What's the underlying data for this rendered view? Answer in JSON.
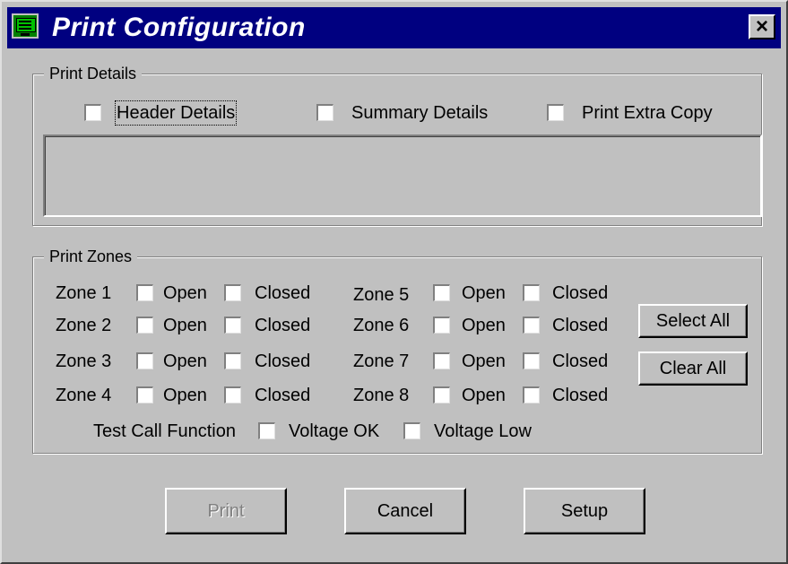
{
  "window": {
    "title": "Print Configuration",
    "close_label": "×"
  },
  "print_details": {
    "legend": "Print Details",
    "checkboxes": [
      {
        "label": "Header Details",
        "checked": false
      },
      {
        "label": "Summary Details",
        "checked": false
      },
      {
        "label": "Print Extra Copy",
        "checked": false
      }
    ]
  },
  "print_zones": {
    "legend": "Print Zones",
    "zones": [
      {
        "label": "Zone 1",
        "open": "Open",
        "closed": "Closed"
      },
      {
        "label": "Zone 2",
        "open": "Open",
        "closed": "Closed"
      },
      {
        "label": "Zone 3",
        "open": "Open",
        "closed": "Closed"
      },
      {
        "label": "Zone 4",
        "open": "Open",
        "closed": "Closed"
      },
      {
        "label": "Zone 5",
        "open": "Open",
        "closed": "Closed"
      },
      {
        "label": "Zone 6",
        "open": "Open",
        "closed": "Closed"
      },
      {
        "label": "Zone 7",
        "open": "Open",
        "closed": "Closed"
      },
      {
        "label": "Zone 8",
        "open": "Open",
        "closed": "Closed"
      }
    ],
    "select_all": "Select All",
    "clear_all": "Clear All",
    "test_call": {
      "label": "Test Call Function",
      "voltage_ok": "Voltage OK",
      "voltage_low": "Voltage Low"
    }
  },
  "buttons": {
    "print": "Print",
    "cancel": "Cancel",
    "setup": "Setup"
  }
}
